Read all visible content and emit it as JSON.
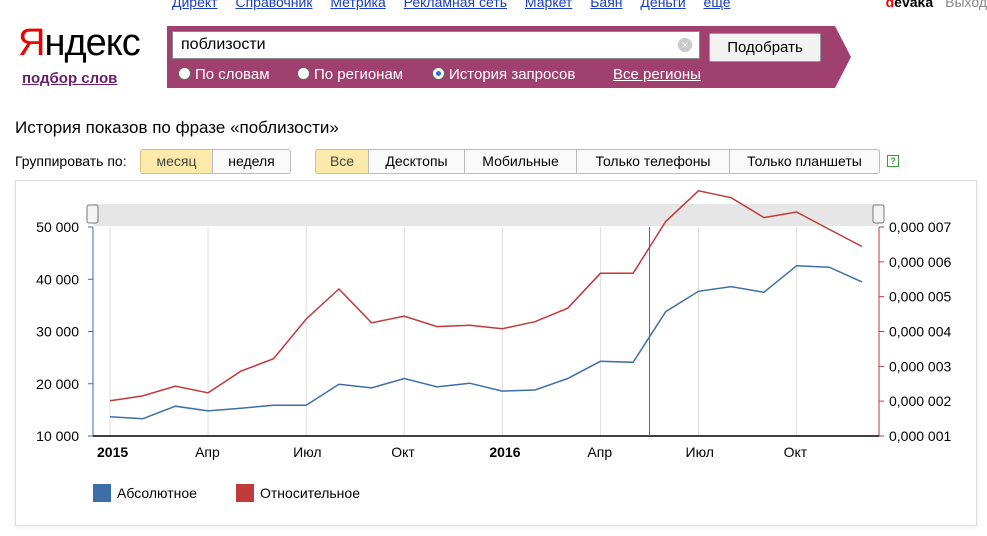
{
  "top_nav": {
    "links": [
      "Директ",
      "Справочник",
      "Метрика",
      "Рекламная сеть",
      "Маркет",
      "Баян",
      "Деньги",
      "еще"
    ],
    "user_first_letter": "d",
    "user_rest": "evaka",
    "exit": "Выход"
  },
  "logo": {
    "first": "Я",
    "rest": "ндекс",
    "sub": "подбор слов"
  },
  "search": {
    "value": "поблизости",
    "clear_icon": "×",
    "submit": "Подобрать",
    "radios": [
      {
        "label": "По словам",
        "selected": false
      },
      {
        "label": "По регионам",
        "selected": false
      },
      {
        "label": "История запросов",
        "selected": true
      }
    ],
    "regions": "Все регионы"
  },
  "page_title": "История показов по фразе «поблизости»",
  "group_label": "Группировать по:",
  "group_buttons": [
    "месяц",
    "неделя"
  ],
  "group_active": "месяц",
  "device_buttons": [
    "Все",
    "Десктопы",
    "Мобильные",
    "Только телефоны",
    "Только планшеты"
  ],
  "device_active": "Все",
  "help_icon": "?",
  "chart_data": {
    "type": "line",
    "x": [
      "2015-01",
      "2015-02",
      "2015-03",
      "2015-04",
      "2015-05",
      "2015-06",
      "2015-07",
      "2015-08",
      "2015-09",
      "2015-10",
      "2015-11",
      "2015-12",
      "2016-01",
      "2016-02",
      "2016-03",
      "2016-04",
      "2016-05",
      "2016-06",
      "2016-07",
      "2016-08",
      "2016-09",
      "2016-10",
      "2016-11",
      "2016-12"
    ],
    "x_tick_labels": [
      {
        "label": "2015",
        "index": 0,
        "bold": true
      },
      {
        "label": "Апр",
        "index": 3,
        "bold": false
      },
      {
        "label": "Июл",
        "index": 6,
        "bold": false
      },
      {
        "label": "Окт",
        "index": 9,
        "bold": false
      },
      {
        "label": "2016",
        "index": 12,
        "bold": true
      },
      {
        "label": "Апр",
        "index": 15,
        "bold": false
      },
      {
        "label": "Июл",
        "index": 18,
        "bold": false
      },
      {
        "label": "Окт",
        "index": 21,
        "bold": false
      }
    ],
    "left_axis": {
      "range": [
        10000,
        50000
      ],
      "ticks": [
        "10 000",
        "20 000",
        "30 000",
        "40 000",
        "50 000"
      ]
    },
    "right_axis": {
      "range": [
        1e-06,
        7e-06
      ],
      "ticks": [
        "0,000 001",
        "0,000 002",
        "0,000 003",
        "0,000 004",
        "0,000 005",
        "0,000 006",
        "0,000 007"
      ]
    },
    "series": [
      {
        "name": "Абсолютное",
        "axis": "left",
        "color": "#3d6ea8",
        "values": [
          13700,
          13300,
          15700,
          14800,
          15300,
          15900,
          15900,
          19900,
          19200,
          21000,
          19400,
          20100,
          18600,
          18800,
          21000,
          24300,
          24100,
          33800,
          37700,
          38600,
          37500,
          42600,
          42300,
          39500
        ]
      },
      {
        "name": "Относительное",
        "axis": "right",
        "color": "#c0393b",
        "values": [
          2.01e-06,
          2.15e-06,
          2.43e-06,
          2.24e-06,
          2.86e-06,
          3.22e-06,
          4.36e-06,
          5.22e-06,
          4.25e-06,
          4.44e-06,
          4.14e-06,
          4.18e-06,
          4.08e-06,
          4.28e-06,
          4.67e-06,
          5.67e-06,
          5.67e-06,
          7.16e-06,
          8.04e-06,
          7.84e-06,
          7.27e-06,
          7.43e-06,
          6.93e-06,
          6.44e-06
        ]
      }
    ],
    "cursor_index": 16.5,
    "legend_position": "bottom-left",
    "grid": true
  }
}
